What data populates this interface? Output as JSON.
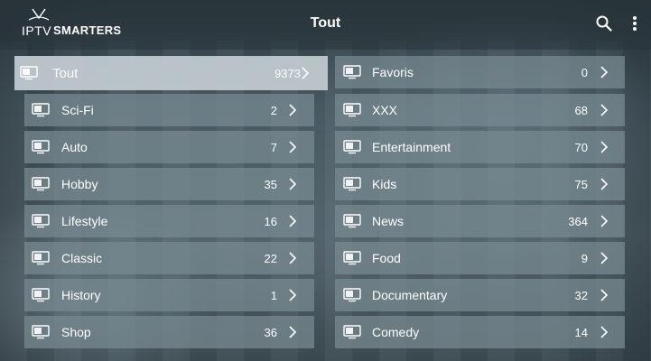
{
  "app": {
    "logo_prefix": "IPTV",
    "logo_name": "SMARTERS",
    "title": "Tout"
  },
  "header": {
    "search_icon": "search-icon",
    "menu_icon": "more-vertical-icon"
  },
  "colors": {
    "row_bg": "#788a92",
    "row_selected_bg": "#c3cdd2",
    "text": "#ffffff"
  },
  "left_column": [
    {
      "label": "Tout",
      "count": "9373",
      "selected": true
    },
    {
      "label": "Sci-Fi",
      "count": "2"
    },
    {
      "label": "Auto",
      "count": "7"
    },
    {
      "label": "Hobby",
      "count": "35"
    },
    {
      "label": "Lifestyle",
      "count": "16"
    },
    {
      "label": "Classic",
      "count": "22"
    },
    {
      "label": "History",
      "count": "1"
    },
    {
      "label": "Shop",
      "count": "36"
    }
  ],
  "right_column": [
    {
      "label": "Favoris",
      "count": "0"
    },
    {
      "label": "XXX",
      "count": "68"
    },
    {
      "label": "Entertainment",
      "count": "70"
    },
    {
      "label": "Kids",
      "count": "75"
    },
    {
      "label": "News",
      "count": "364"
    },
    {
      "label": "Food",
      "count": "9"
    },
    {
      "label": "Documentary",
      "count": "32"
    },
    {
      "label": "Comedy",
      "count": "14"
    }
  ]
}
